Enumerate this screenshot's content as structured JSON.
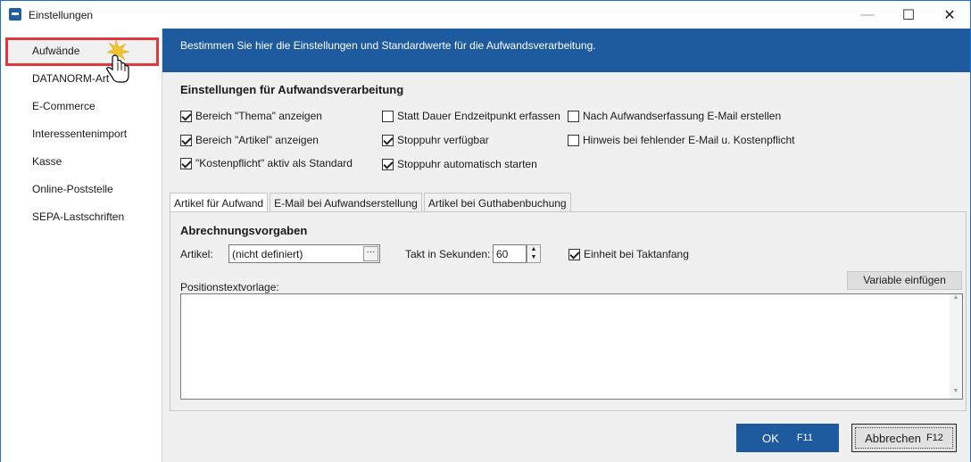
{
  "window": {
    "title": "Einstellungen",
    "minimize_glyph": "—",
    "maximize_glyph": "☐",
    "close_glyph": "✕"
  },
  "sidebar": {
    "items": [
      {
        "label": "Aufwände"
      },
      {
        "label": "DATANORM-Art"
      },
      {
        "label": "E-Commerce"
      },
      {
        "label": "Interessentenimport"
      },
      {
        "label": "Kasse"
      },
      {
        "label": "Online-Poststelle"
      },
      {
        "label": "SEPA-Lastschriften"
      }
    ]
  },
  "banner": {
    "text": "Bestimmen Sie hier die Einstellungen und Standardwerte für die Aufwandsverarbeitung."
  },
  "settings": {
    "title": "Einstellungen für Aufwandsverarbeitung",
    "checkboxes": [
      {
        "label": "Bereich \"Thema\" anzeigen",
        "checked": true
      },
      {
        "label": "Bereich \"Artikel\" anzeigen",
        "checked": true
      },
      {
        "label": "\"Kostenpflicht\" aktiv als Standard",
        "checked": true
      },
      {
        "label": "Statt Dauer Endzeitpunkt erfassen",
        "checked": false
      },
      {
        "label": "Stoppuhr verfügbar",
        "checked": true
      },
      {
        "label": "Stoppuhr automatisch starten",
        "checked": true
      },
      {
        "label": "Nach Aufwandserfassung E-Mail erstellen",
        "checked": false
      },
      {
        "label": "Hinweis bei fehlender E-Mail u. Kostenpflicht",
        "checked": false
      }
    ]
  },
  "tabs": [
    {
      "label": "Artikel für Aufwand"
    },
    {
      "label": "E-Mail bei Aufwandserstellung"
    },
    {
      "label": "Artikel bei Guthabenbuchung"
    }
  ],
  "panel": {
    "title": "Abrechnungsvorgaben",
    "artikel_label": "Artikel:",
    "artikel_value": "(nicht definiert)",
    "ellipsis": "···",
    "takt_label": "Takt in Sekunden:",
    "takt_value": "60",
    "einheit_label": "Einheit bei Taktanfang",
    "einheit_checked": true,
    "position_label": "Positionstextvorlage:",
    "variable_button": "Variable einfügen",
    "position_text": ""
  },
  "buttons": {
    "ok_label": "OK",
    "ok_key": "F11",
    "cancel_label": "Abbrechen",
    "cancel_key": "F12"
  },
  "colors": {
    "accent": "#1d5a9e",
    "highlight": "#e0383e"
  }
}
